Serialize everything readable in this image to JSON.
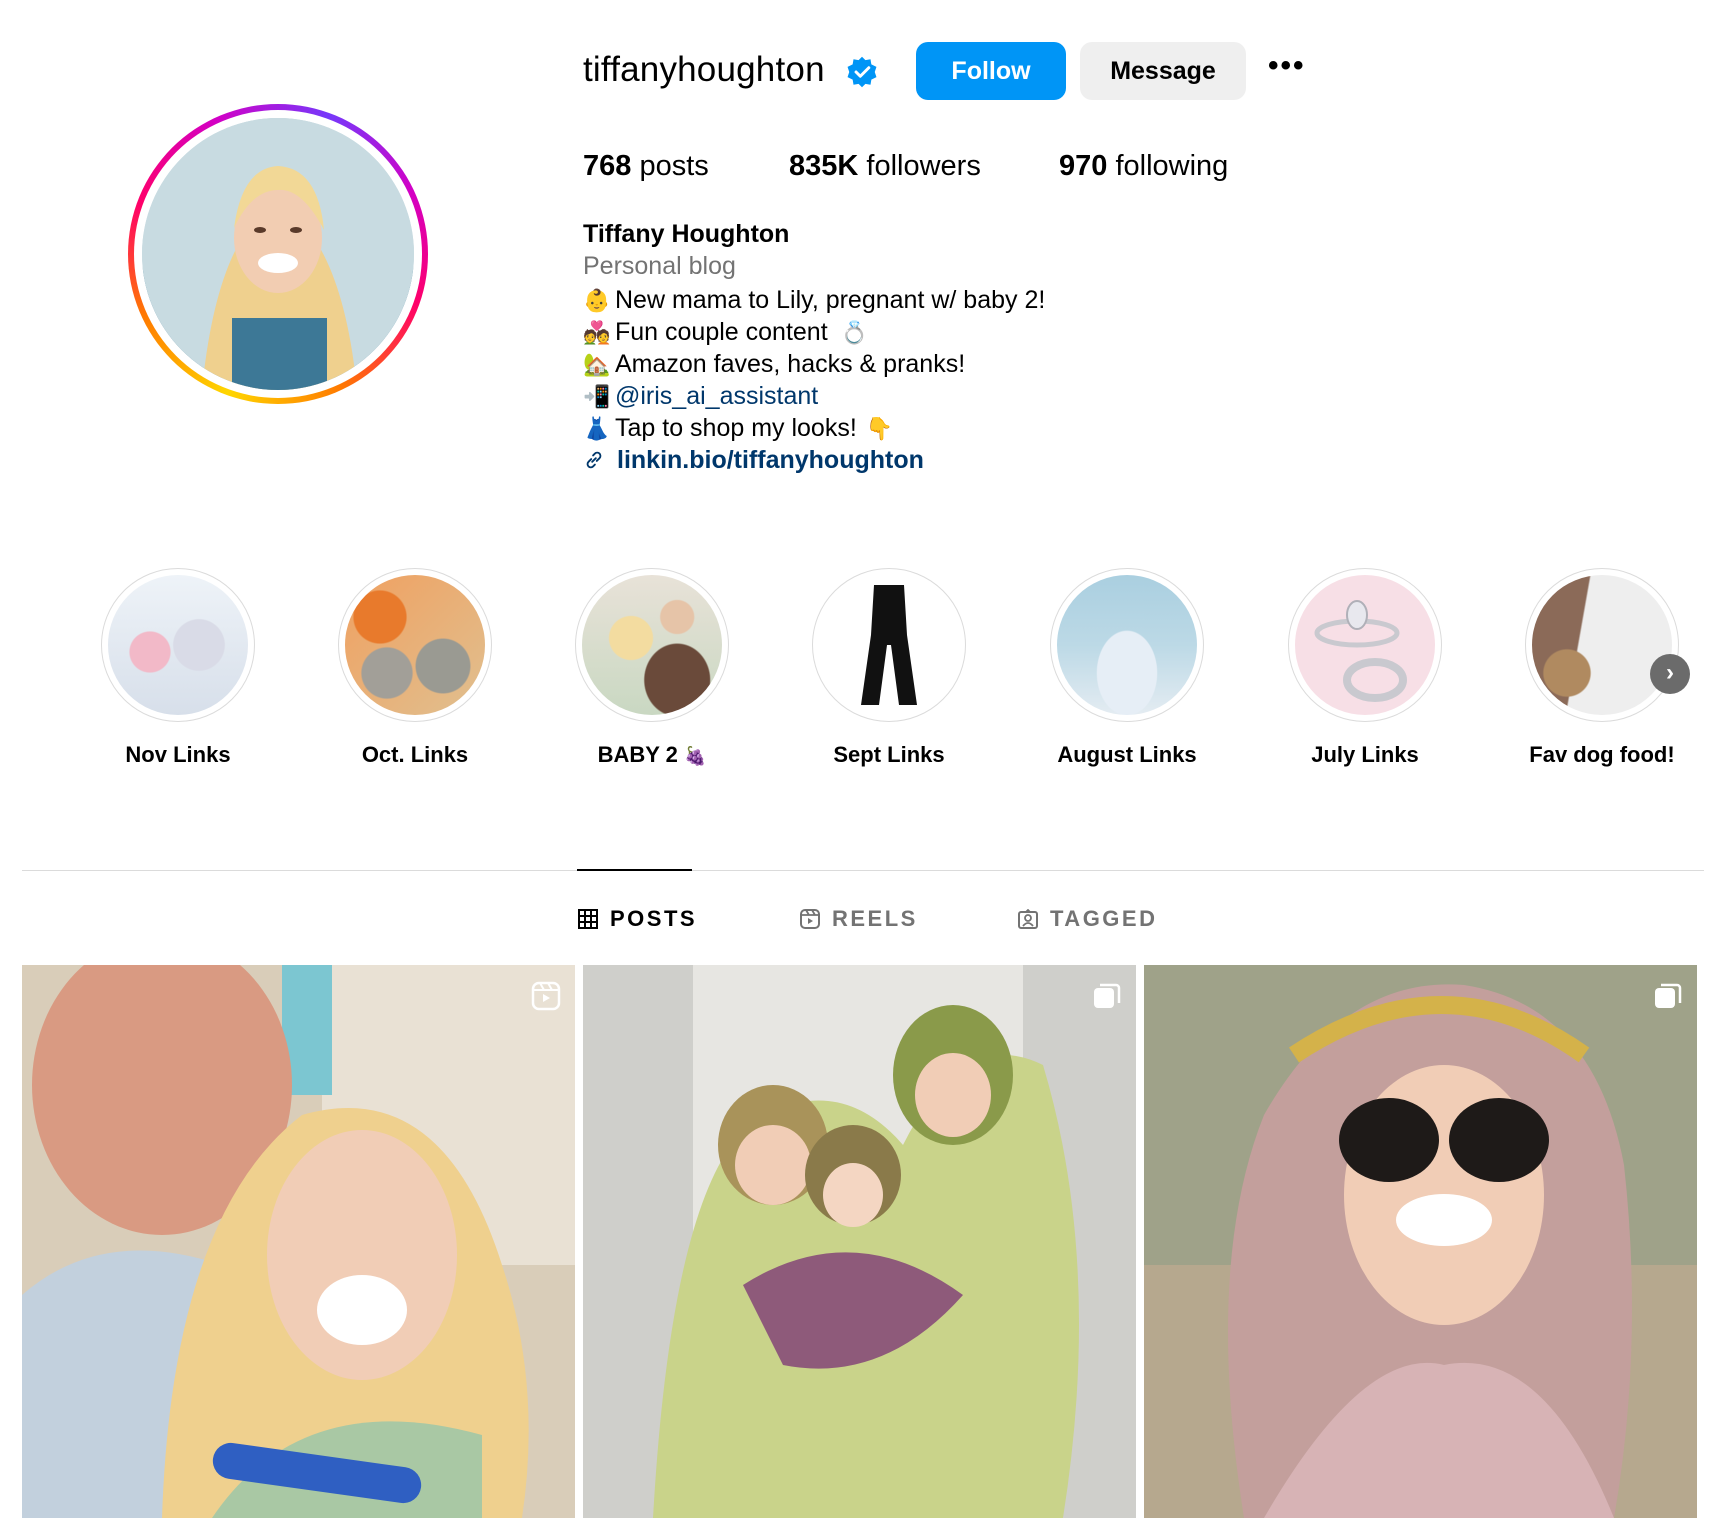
{
  "profile": {
    "username": "tiffanyhoughton",
    "verified": true,
    "follow_label": "Follow",
    "message_label": "Message",
    "more_label": "•••",
    "stats": {
      "posts_count": "768",
      "posts_label": "posts",
      "followers_count": "835K",
      "followers_label": "followers",
      "following_count": "970",
      "following_label": "following"
    },
    "bio": {
      "name": "Tiffany Houghton",
      "category": "Personal blog",
      "lines": [
        {
          "emoji": "👶",
          "text": "New mama to Lily, pregnant w/ baby 2!"
        },
        {
          "emoji": "💑",
          "text": "Fun couple content",
          "trailing_emoji": "💍"
        },
        {
          "emoji": "🏡",
          "text": "Amazon faves, hacks & pranks!"
        },
        {
          "emoji": "📲",
          "mention": "@iris_ai_assistant"
        },
        {
          "emoji": "👗",
          "text": "Tap to shop my looks!",
          "trailing_emoji": "👇"
        }
      ],
      "link": "linkin.bio/tiffanyhoughton"
    },
    "accent_color": "#0095f6",
    "link_color": "#00376b"
  },
  "highlights": [
    {
      "label": "Nov Links",
      "icon": "tumblers-thumbnail"
    },
    {
      "label": "Oct. Links",
      "icon": "sneakers-pumpkins-thumbnail"
    },
    {
      "label": "BABY 2",
      "emoji": "🍇",
      "icon": "couple-selfie-thumbnail"
    },
    {
      "label": "Sept Links",
      "icon": "flare-leggings-thumbnail"
    },
    {
      "label": "August Links",
      "icon": "bottles-thumbnail"
    },
    {
      "label": "July Links",
      "icon": "rings-thumbnail"
    },
    {
      "label": "Fav dog food!",
      "icon": "dog-food-thumbnail"
    }
  ],
  "tabs": [
    {
      "label": "POSTS",
      "icon": "grid-icon",
      "active": true
    },
    {
      "label": "REELS",
      "icon": "reels-icon",
      "active": false
    },
    {
      "label": "TAGGED",
      "icon": "tagged-icon",
      "active": false
    }
  ],
  "posts": [
    {
      "type": "reel",
      "badge_icon": "reel-icon"
    },
    {
      "type": "carousel",
      "badge_icon": "carousel-icon"
    },
    {
      "type": "carousel",
      "badge_icon": "carousel-icon"
    }
  ]
}
